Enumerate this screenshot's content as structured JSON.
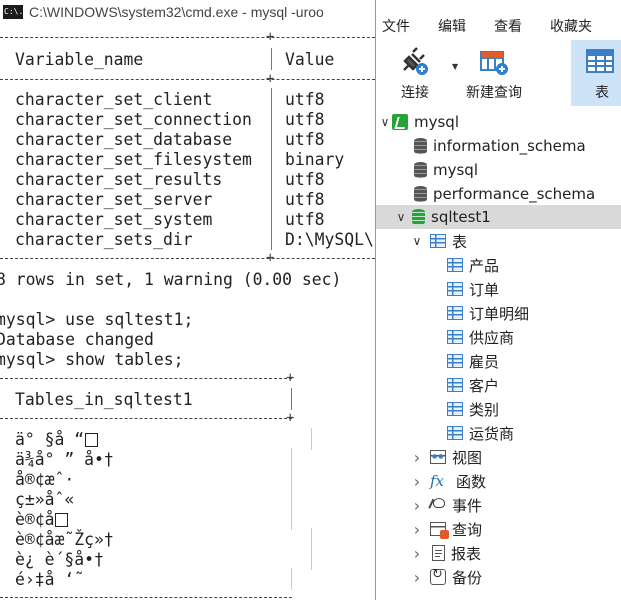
{
  "cmd": {
    "title": "C:\\WINDOWS\\system32\\cmd.exe - mysql  -uroo",
    "icon_text": "C:\\.",
    "header_cols": [
      "Variable_name",
      "Value"
    ],
    "rows": [
      {
        "name": "character_set_client",
        "value": "utf8"
      },
      {
        "name": "character_set_connection",
        "value": "utf8"
      },
      {
        "name": "character_set_database",
        "value": "utf8"
      },
      {
        "name": "character_set_filesystem",
        "value": "binary"
      },
      {
        "name": "character_set_results",
        "value": "utf8"
      },
      {
        "name": "character_set_server",
        "value": "utf8"
      },
      {
        "name": "character_set_system",
        "value": "utf8"
      },
      {
        "name": "character_sets_dir",
        "value": "D:\\MySQL\\"
      }
    ],
    "summary": "8 rows in set, 1 warning (0.00 sec)",
    "commands": [
      {
        "prompt": "mysql> ",
        "text": "use sqltest1;"
      },
      {
        "prompt": "",
        "text": "Database changed"
      },
      {
        "prompt": "mysql> ",
        "text": "show tables;"
      }
    ],
    "tables_header": "Tables_in_sqltest1",
    "table_rows": [
      "ä° §å “",
      "ä¾å° ” å•†",
      "å®¢æˆ·",
      "ç±»åˆ«",
      "è®¢å",
      "è®¢åæ˜Žç»†",
      "è¿ è´§å•†",
      "é›‡å ‘˜"
    ]
  },
  "navicat": {
    "menu": [
      "文件",
      "编辑",
      "查看",
      "收藏夹"
    ],
    "toolbar": [
      {
        "label": "连接",
        "icon": "plug-icon"
      },
      {
        "label": "新建查询",
        "icon": "new-query-icon"
      },
      {
        "label": "表",
        "icon": "table-icon"
      }
    ],
    "tree": {
      "connection": "mysql",
      "databases": [
        "information_schema",
        "mysql",
        "performance_schema",
        "sqltest1"
      ],
      "tables_group": "表",
      "tables": [
        "产品",
        "订单",
        "订单明细",
        "供应商",
        "雇员",
        "客户",
        "类别",
        "运货商"
      ],
      "groups": [
        "视图",
        "函数",
        "事件",
        "查询",
        "报表",
        "备份"
      ]
    }
  }
}
